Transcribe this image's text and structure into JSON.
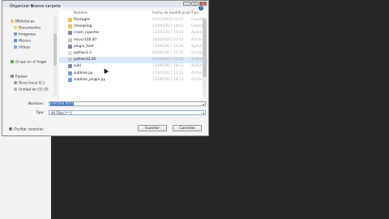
{
  "toolbar": {
    "organize_label": "Organizar ▾",
    "new_folder_label": "Nueva carpeta"
  },
  "nav": {
    "items": [
      {
        "label": "Bibliotecas",
        "icon": "library-icon"
      },
      {
        "label": "Documentos",
        "icon": "documents-icon"
      },
      {
        "label": "Imágenes",
        "icon": "images-icon"
      },
      {
        "label": "Música",
        "icon": "music-icon"
      },
      {
        "label": "Vídeos",
        "icon": "videos-icon"
      },
      {
        "label": "Grupo en el hogar",
        "icon": "homegroup-icon"
      },
      {
        "label": "Equipo",
        "icon": "computer-icon"
      },
      {
        "label": "Disco local (C:)",
        "icon": "drive-icon"
      },
      {
        "label": "Unidad de CD (D:",
        "icon": "cd-drive-icon"
      }
    ]
  },
  "file_list": {
    "headers": {
      "name": "Nombre",
      "date": "Fecha de modificación",
      "type": "Tipo"
    },
    "rows": [
      {
        "name": "Packages",
        "date": "07/11/2020 23:07",
        "type": "Carpet",
        "icon": "folder-icon"
      },
      {
        "name": "changelog",
        "date": "13/09/2017 18:51",
        "type": "Carpet",
        "icon": "folder-icon"
      },
      {
        "name": "crash_reporter",
        "date": "13/09/2017 16:13",
        "type": "Aplica",
        "icon": "app-icon"
      },
      {
        "name": "msvcr100.dll",
        "date": "18/03/2010 23:43",
        "type": "Archiv",
        "icon": "dll-icon"
      },
      {
        "name": "plugin_host",
        "date": "13/09/2017 15:48",
        "type": "Aplica",
        "icon": "app-icon"
      },
      {
        "name": "python3.3",
        "date": "02/06/2017 15:52",
        "type": "Archiv",
        "icon": "file-icon"
      },
      {
        "name": "python33.dll",
        "date": "27/08/2017 12:21",
        "type": "Archiv",
        "icon": "dll-icon"
      },
      {
        "name": "subl",
        "date": "13/09/2017 18:13",
        "type": "Aplica",
        "icon": "app-icon"
      },
      {
        "name": "sublime.py",
        "date": "27/07/2017 12:23",
        "type": "Archiv",
        "icon": "py-icon"
      },
      {
        "name": "sublime_plugin.py",
        "date": "13/09/2017 18:13",
        "type": "Archiv",
        "icon": "py-icon"
      }
    ],
    "selected_index": 6
  },
  "form": {
    "name_label": "Nombre:",
    "name_value": "untitled.html",
    "type_label": "Tipo:",
    "type_value": "All Files (*.*)",
    "save_label": "Guardar",
    "cancel_label": "Cancelar",
    "hide_folders_label": "Ocultar carpetas"
  },
  "colors": {
    "editor_bg": "#262626",
    "selection": "#2f6dc2"
  }
}
